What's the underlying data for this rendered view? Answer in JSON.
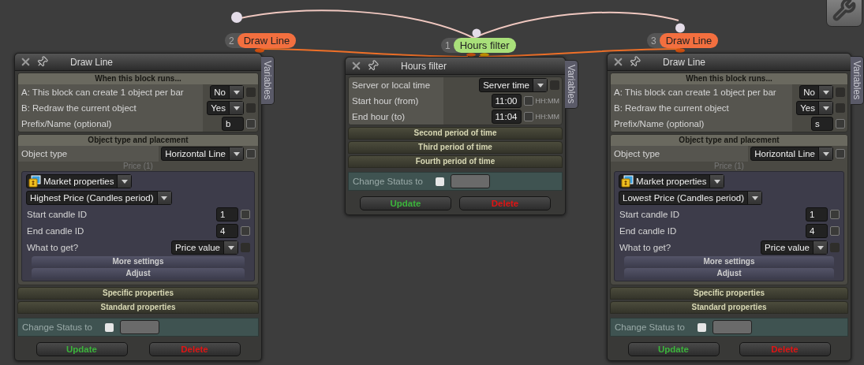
{
  "blocks": [
    {
      "number": "2",
      "tag": "Draw Line",
      "color": "#f36f3f",
      "title": "Draw Line",
      "side_tab": "Variables",
      "groups": [
        {
          "kind": "section",
          "heading": "When this block runs...",
          "rows": [
            {
              "kind": "select",
              "label": "A: This block can create 1 object per bar",
              "value": "No",
              "checkbox": {
                "checked": false,
                "disabled": true
              }
            },
            {
              "kind": "select",
              "label": "B: Redraw the current object",
              "value": "Yes",
              "checkbox": {
                "checked": false,
                "disabled": true
              }
            },
            {
              "kind": "input",
              "label": "Prefix/Name (optional)",
              "value": "b",
              "checkbox": {
                "checked": false,
                "disabled": false
              }
            }
          ]
        },
        {
          "kind": "section",
          "heading": "Object type and placement",
          "rows": [
            {
              "kind": "select",
              "label": "Object type",
              "value": "Horizontal Line",
              "checkbox": {
                "checked": false,
                "disabled": false
              }
            },
            {
              "kind": "subgroup",
              "caption": "Price (1)",
              "rows": [
                {
                  "kind": "source",
                  "value": "Market properties"
                },
                {
                  "kind": "select",
                  "value": "Highest Price (Candles period)"
                },
                {
                  "kind": "input",
                  "label": "Start candle ID",
                  "value": "1",
                  "checkbox": {
                    "checked": false,
                    "disabled": false
                  }
                },
                {
                  "kind": "input",
                  "label": "End candle ID",
                  "value": "4",
                  "checkbox": {
                    "checked": false,
                    "disabled": false
                  }
                },
                {
                  "kind": "select",
                  "label": "What to get?",
                  "value": "Price value",
                  "checkbox": {
                    "checked": false,
                    "disabled": true
                  }
                },
                {
                  "kind": "bar",
                  "label": "More settings"
                },
                {
                  "kind": "bar",
                  "label": "Adjust"
                }
              ]
            }
          ]
        },
        {
          "kind": "collapsed",
          "heading": "Specific properties"
        },
        {
          "kind": "collapsed",
          "heading": "Standard properties"
        }
      ],
      "status": {
        "label": "Change Status to",
        "checked": false
      },
      "buttons": [
        {
          "kind": "update",
          "label": "Update"
        },
        {
          "kind": "delete",
          "label": "Delete"
        }
      ]
    },
    {
      "number": "1",
      "tag": "Hours filter",
      "color": "#a9e07a",
      "title": "Hours filter",
      "side_tab": "Variables",
      "groups": [
        {
          "kind": "section",
          "rows": [
            {
              "kind": "select",
              "label": "Server or local time",
              "value": "Server time",
              "checkbox": {
                "checked": false,
                "disabled": true
              }
            },
            {
              "kind": "input",
              "label": "Start hour (from)",
              "value": "11:00",
              "hint": "HH:MM",
              "checkbox": {
                "checked": false,
                "disabled": false
              }
            },
            {
              "kind": "input",
              "label": "End hour (to)",
              "value": "11:04",
              "hint": "HH:MM",
              "checkbox": {
                "checked": false,
                "disabled": false
              }
            }
          ]
        },
        {
          "kind": "collapsed",
          "heading": "Second period of time"
        },
        {
          "kind": "collapsed",
          "heading": "Third period of time"
        },
        {
          "kind": "collapsed",
          "heading": "Fourth period of time"
        }
      ],
      "status": {
        "label": "Change Status to",
        "checked": false
      },
      "buttons": [
        {
          "kind": "update",
          "label": "Update"
        },
        {
          "kind": "delete",
          "label": "Delete"
        }
      ]
    },
    {
      "number": "3",
      "tag": "Draw Line",
      "color": "#f36f3f",
      "title": "Draw Line",
      "side_tab": "Variables",
      "groups": [
        {
          "kind": "section",
          "heading": "When this block runs...",
          "rows": [
            {
              "kind": "select",
              "label": "A: This block can create 1 object per bar",
              "value": "No",
              "checkbox": {
                "checked": false,
                "disabled": true
              }
            },
            {
              "kind": "select",
              "label": "B: Redraw the current object",
              "value": "Yes",
              "checkbox": {
                "checked": false,
                "disabled": true
              }
            },
            {
              "kind": "input",
              "label": "Prefix/Name (optional)",
              "value": "s",
              "checkbox": {
                "checked": false,
                "disabled": false
              }
            }
          ]
        },
        {
          "kind": "section",
          "heading": "Object type and placement",
          "rows": [
            {
              "kind": "select",
              "label": "Object type",
              "value": "Horizontal Line",
              "checkbox": {
                "checked": false,
                "disabled": false
              }
            },
            {
              "kind": "subgroup",
              "caption": "Price (1)",
              "rows": [
                {
                  "kind": "source",
                  "value": "Market properties"
                },
                {
                  "kind": "select",
                  "value": "Lowest Price (Candles period)"
                },
                {
                  "kind": "input",
                  "label": "Start candle ID",
                  "value": "1",
                  "checkbox": {
                    "checked": false,
                    "disabled": false
                  }
                },
                {
                  "kind": "input",
                  "label": "End candle ID",
                  "value": "4",
                  "checkbox": {
                    "checked": false,
                    "disabled": false
                  }
                },
                {
                  "kind": "select",
                  "label": "What to get?",
                  "value": "Price value",
                  "checkbox": {
                    "checked": false,
                    "disabled": true
                  }
                },
                {
                  "kind": "bar",
                  "label": "More settings"
                },
                {
                  "kind": "bar",
                  "label": "Adjust"
                }
              ]
            }
          ]
        },
        {
          "kind": "collapsed",
          "heading": "Specific properties"
        },
        {
          "kind": "collapsed",
          "heading": "Standard properties"
        }
      ],
      "status": {
        "label": "Change Status to",
        "checked": false
      },
      "buttons": [
        {
          "kind": "update",
          "label": "Update"
        },
        {
          "kind": "delete",
          "label": "Delete"
        }
      ]
    }
  ]
}
